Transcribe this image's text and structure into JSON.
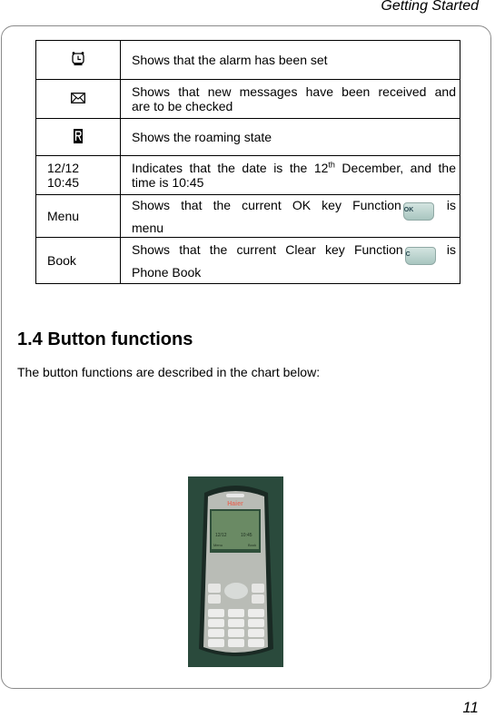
{
  "header": {
    "running_title": "Getting Started"
  },
  "status_table": {
    "rows": [
      {
        "symbol_icon": "alarm-clock-icon",
        "symbol_text": "",
        "description": [
          "Shows that the alarm has been set"
        ]
      },
      {
        "symbol_icon": "envelope-icon",
        "symbol_text": "",
        "description": [
          "Shows that new messages have been received and",
          "are to be checked"
        ]
      },
      {
        "symbol_icon": "roaming-r-icon",
        "symbol_text": "",
        "description": [
          "Shows the roaming state"
        ]
      },
      {
        "symbol_icon": "",
        "symbol_text": [
          "12/12",
          "10:45"
        ],
        "description_pre": "Indicates that the date is the 12",
        "description_sup": "th",
        "description_post": " December, and the",
        "description_line2": "time is 10:45"
      },
      {
        "symbol_icon": "",
        "symbol_text": "Menu",
        "description_pre": "Shows  that  the  current  OK  key  Function",
        "key_label": "OK",
        "key_icon": "ok-key-icon",
        "description_post": " is",
        "description_line2": "menu"
      },
      {
        "symbol_icon": "",
        "symbol_text": "Book",
        "description_pre": "Shows  that  the  current  Clear  key  Function",
        "key_label": "C",
        "key_icon": "clear-key-icon",
        "description_post": " is",
        "description_line2": "Phone Book"
      }
    ]
  },
  "section": {
    "title": "1.4 Button functions",
    "intro": "The button functions are described in the chart below:"
  },
  "phone": {
    "brand": "Haier",
    "screen_date": "12/12",
    "screen_time": "10:45",
    "left_softkey": "Menu",
    "right_softkey": "Book",
    "keys": [
      "OK",
      "C",
      "1",
      "2",
      "3",
      "4",
      "5",
      "6",
      "7",
      "8",
      "9",
      "*",
      "0",
      "#"
    ]
  },
  "footer": {
    "page_number": "11"
  }
}
